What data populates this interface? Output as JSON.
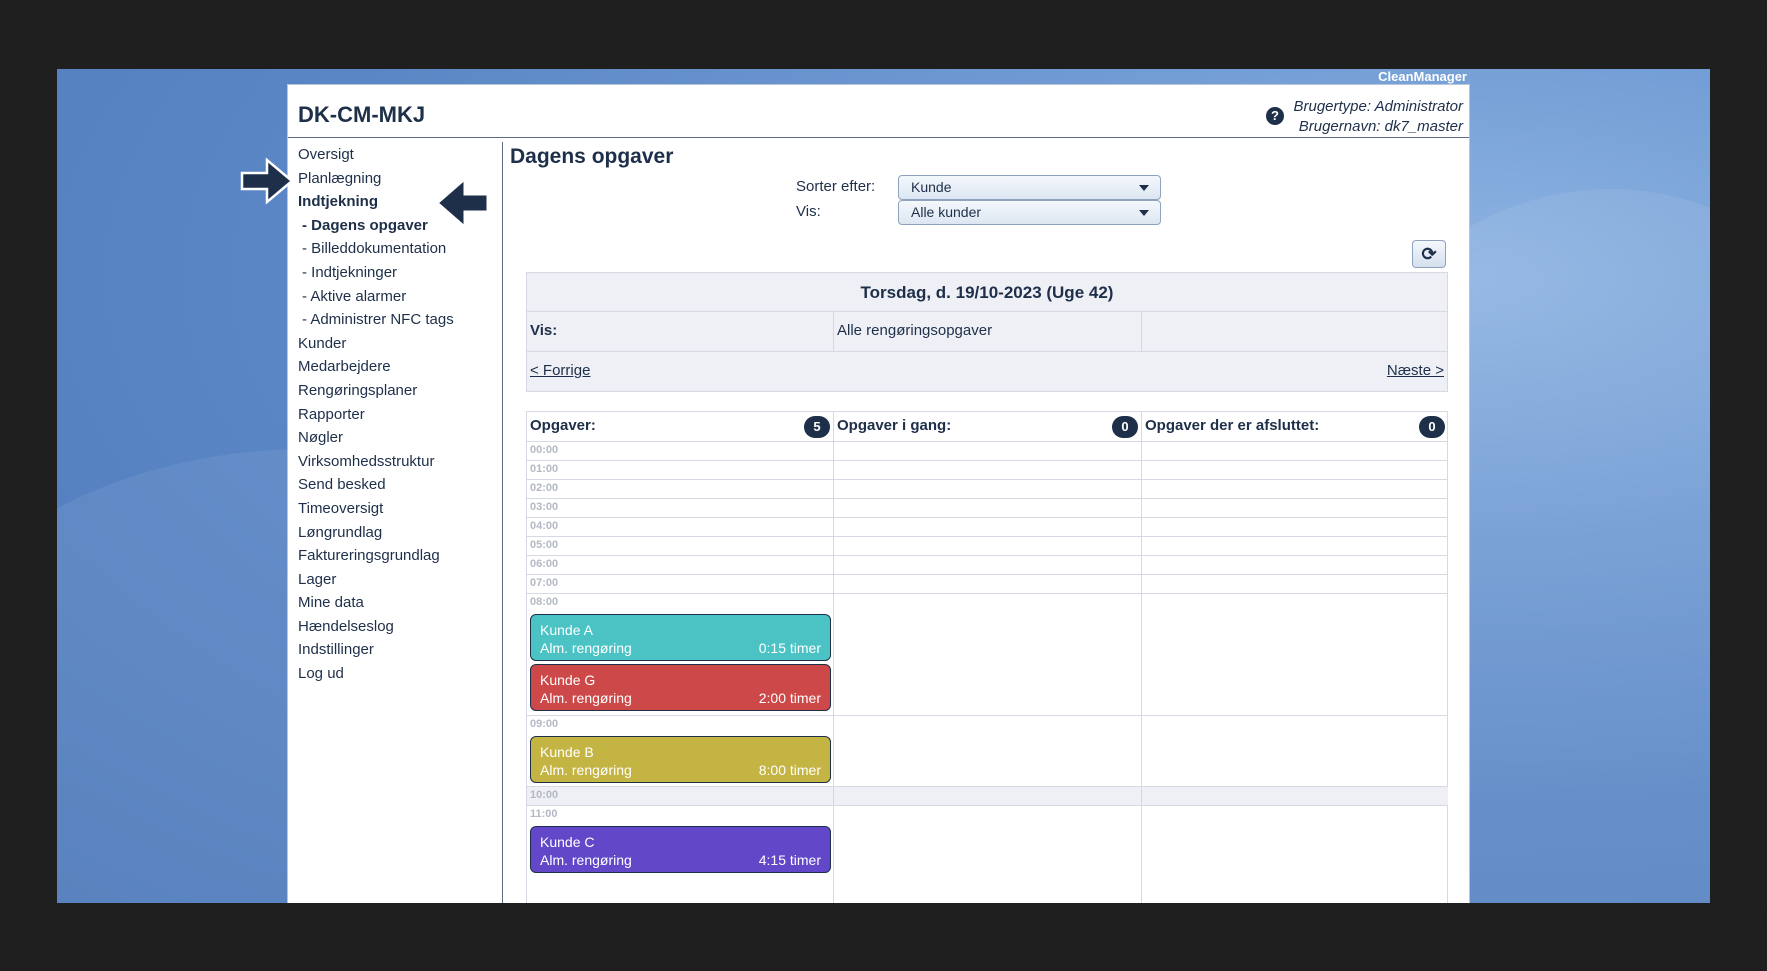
{
  "app": {
    "brand": "CleanManager"
  },
  "header": {
    "company": "DK-CM-MKJ",
    "help_icon": "question-circle-icon",
    "user_type": "Brugertype: Administrator",
    "user_name": "Brugernavn: dk7_master"
  },
  "sidebar": {
    "items": [
      {
        "label": "Oversigt"
      },
      {
        "label": "Planlægning"
      },
      {
        "label": "Indtjekning"
      },
      {
        "label": "- Dagens opgaver"
      },
      {
        "label": "- Billeddokumentation"
      },
      {
        "label": "- Indtjekninger"
      },
      {
        "label": "- Aktive alarmer"
      },
      {
        "label": "- Administrer NFC tags"
      },
      {
        "label": "Kunder"
      },
      {
        "label": "Medarbejdere"
      },
      {
        "label": "Rengøringsplaner"
      },
      {
        "label": "Rapporter"
      },
      {
        "label": "Nøgler"
      },
      {
        "label": "Virksomhedsstruktur"
      },
      {
        "label": "Send besked"
      },
      {
        "label": "Timeoversigt"
      },
      {
        "label": "Løngrundlag"
      },
      {
        "label": "Faktureringsgrundlag"
      },
      {
        "label": "Lager"
      },
      {
        "label": "Mine data"
      },
      {
        "label": "Hændelseslog"
      },
      {
        "label": "Indstillinger"
      },
      {
        "label": "Log ud"
      }
    ]
  },
  "main": {
    "title": "Dagens opgaver",
    "sort_label": "Sorter efter:",
    "sort_value": "Kunde",
    "show_label": "Vis:",
    "show_value": "Alle kunder",
    "refresh_icon": "refresh-icon",
    "date": "Torsdag, d. 19/10-2023 (Uge 42)",
    "filter_label": "Vis:",
    "filter_value": "Alle rengøringsopgaver",
    "prev": "< Forrige",
    "next": "Næste >"
  },
  "columns": [
    {
      "title": "Opgaver:",
      "count": "5"
    },
    {
      "title": "Opgaver i gang:",
      "count": "0"
    },
    {
      "title": "Opgaver der er afsluttet:",
      "count": "0"
    }
  ],
  "times": [
    "00:00",
    "01:00",
    "02:00",
    "03:00",
    "04:00",
    "05:00",
    "06:00",
    "07:00",
    "08:00",
    "09:00",
    "10:00",
    "11:00"
  ],
  "tasks": [
    {
      "customer": "Kunde A",
      "type": "Alm. rengøring",
      "hours": "0:15 timer",
      "color": "#4bc3c5"
    },
    {
      "customer": "Kunde G",
      "type": "Alm. rengøring",
      "hours": "2:00 timer",
      "color": "#cd4848"
    },
    {
      "customer": "Kunde B",
      "type": "Alm. rengøring",
      "hours": "8:00 timer",
      "color": "#c4b443"
    },
    {
      "customer": "Kunde C",
      "type": "Alm. rengøring",
      "hours": "4:15 timer",
      "color": "#6248c9"
    }
  ],
  "annotations": {
    "arrow_icon": "arrow-icon"
  }
}
